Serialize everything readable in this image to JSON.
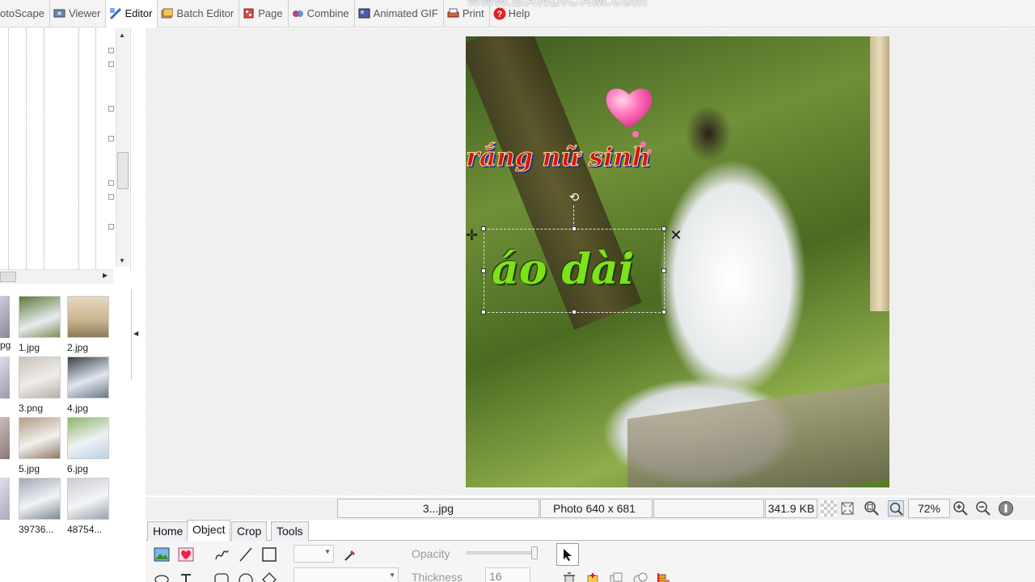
{
  "top_tabs": [
    {
      "label": "otoScape",
      "icon": "photoscape-icon"
    },
    {
      "label": "Viewer",
      "icon": "viewer-icon"
    },
    {
      "label": "Editor",
      "icon": "editor-icon"
    },
    {
      "label": "Batch Editor",
      "icon": "batch-editor-icon"
    },
    {
      "label": "Page",
      "icon": "page-icon"
    },
    {
      "label": "Combine",
      "icon": "combine-icon"
    },
    {
      "label": "Animated GIF",
      "icon": "animated-gif-icon"
    },
    {
      "label": "Print",
      "icon": "print-icon"
    },
    {
      "label": "Help",
      "icon": "help-icon"
    }
  ],
  "watermark": "www.BANDICAM.com",
  "thumbnails": [
    {
      "name": "1.jpg"
    },
    {
      "name": "2.jpg"
    },
    {
      "name": "3.png"
    },
    {
      "name": "4.jpg"
    },
    {
      "name": "5.jpg"
    },
    {
      "name": "6.jpg"
    },
    {
      "name": "39736..."
    },
    {
      "name": "48754..."
    }
  ],
  "thumb_edge_labels": [
    "pg"
  ],
  "canvas": {
    "text_top": "rắng nữ sinh",
    "text_selected": "áo dài"
  },
  "status": {
    "file": "3...jpg",
    "dimensions": "Photo 640 x 681",
    "size": "341.9 KB",
    "zoom": "72%"
  },
  "bottom_tabs": [
    {
      "label": "Home"
    },
    {
      "label": "Object"
    },
    {
      "label": "Crop"
    },
    {
      "label": "Tools"
    }
  ],
  "object_panel": {
    "opacity_label": "Opacity",
    "thickness_label": "Thickness",
    "thickness_value": "16"
  },
  "colors": {
    "accent_red": "#d41515",
    "accent_green": "#7ee21a"
  }
}
